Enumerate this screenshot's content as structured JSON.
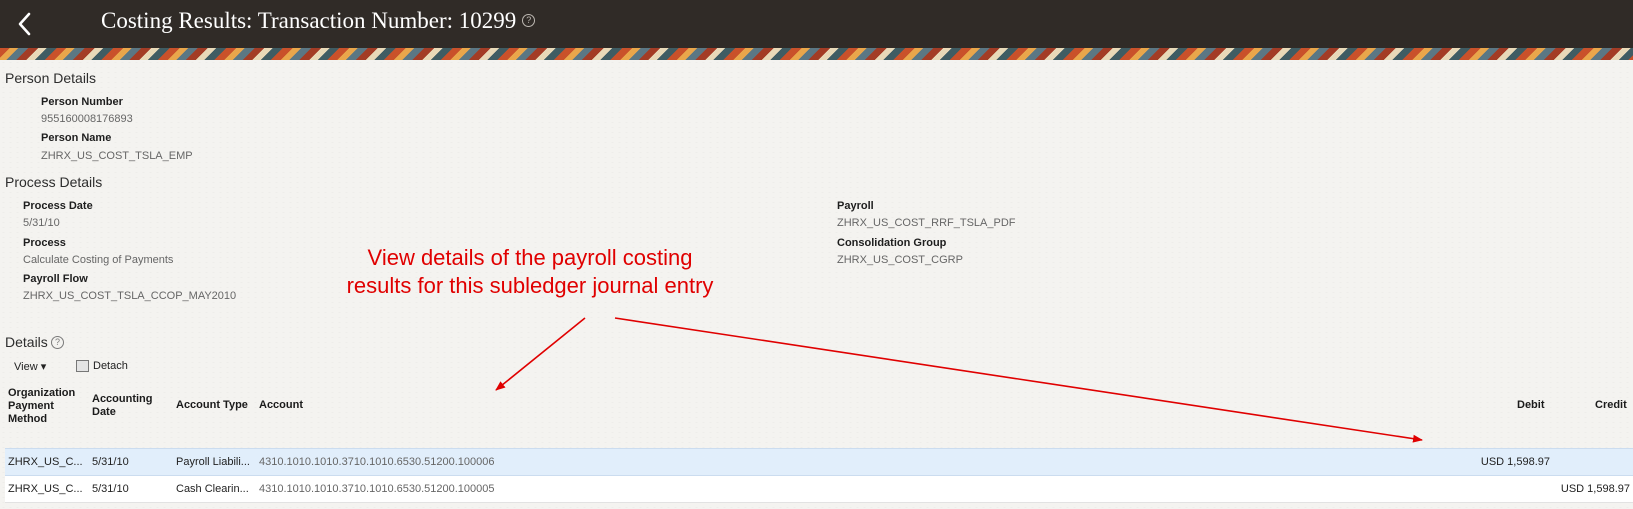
{
  "header": {
    "title": "Costing Results: Transaction Number: 10299"
  },
  "person_details": {
    "title": "Person Details",
    "person_number_label": "Person Number",
    "person_number": "955160008176893",
    "person_name_label": "Person Name",
    "person_name": "ZHRX_US_COST_TSLA_EMP"
  },
  "process_details": {
    "title": "Process Details",
    "process_date_label": "Process Date",
    "process_date": "5/31/10",
    "process_label": "Process",
    "process": "Calculate Costing of Payments",
    "payroll_flow_label": "Payroll Flow",
    "payroll_flow": "ZHRX_US_COST_TSLA_CCOP_MAY2010",
    "payroll_label": "Payroll",
    "payroll": "ZHRX_US_COST_RRF_TSLA_PDF",
    "consolidation_group_label": "Consolidation Group",
    "consolidation_group": "ZHRX_US_COST_CGRP"
  },
  "details": {
    "title": "Details",
    "view_label": "View ▾",
    "detach_label": "Detach",
    "columns": {
      "org_payment_method": [
        "Organization",
        "Payment",
        "Method"
      ],
      "accounting_date": [
        "Accounting",
        "Date"
      ],
      "account_type": "Account Type",
      "account": "Account",
      "debit": "Debit",
      "credit": "Credit"
    },
    "rows": [
      {
        "org_payment_method": "ZHRX_US_C...",
        "accounting_date": "5/31/10",
        "account_type": "Payroll Liabili...",
        "account": "4310.1010.1010.3710.1010.6530.51200.100006",
        "debit": "USD 1,598.97",
        "credit": ""
      },
      {
        "org_payment_method": "ZHRX_US_C...",
        "accounting_date": "5/31/10",
        "account_type": "Cash Clearin...",
        "account": "4310.1010.1010.3710.1010.6530.51200.100005",
        "debit": "",
        "credit": "USD 1,598.97"
      }
    ]
  },
  "annotation": {
    "line1": "View details of the payroll costing",
    "line2": "results for this subledger journal entry",
    "color": "#e00000"
  }
}
